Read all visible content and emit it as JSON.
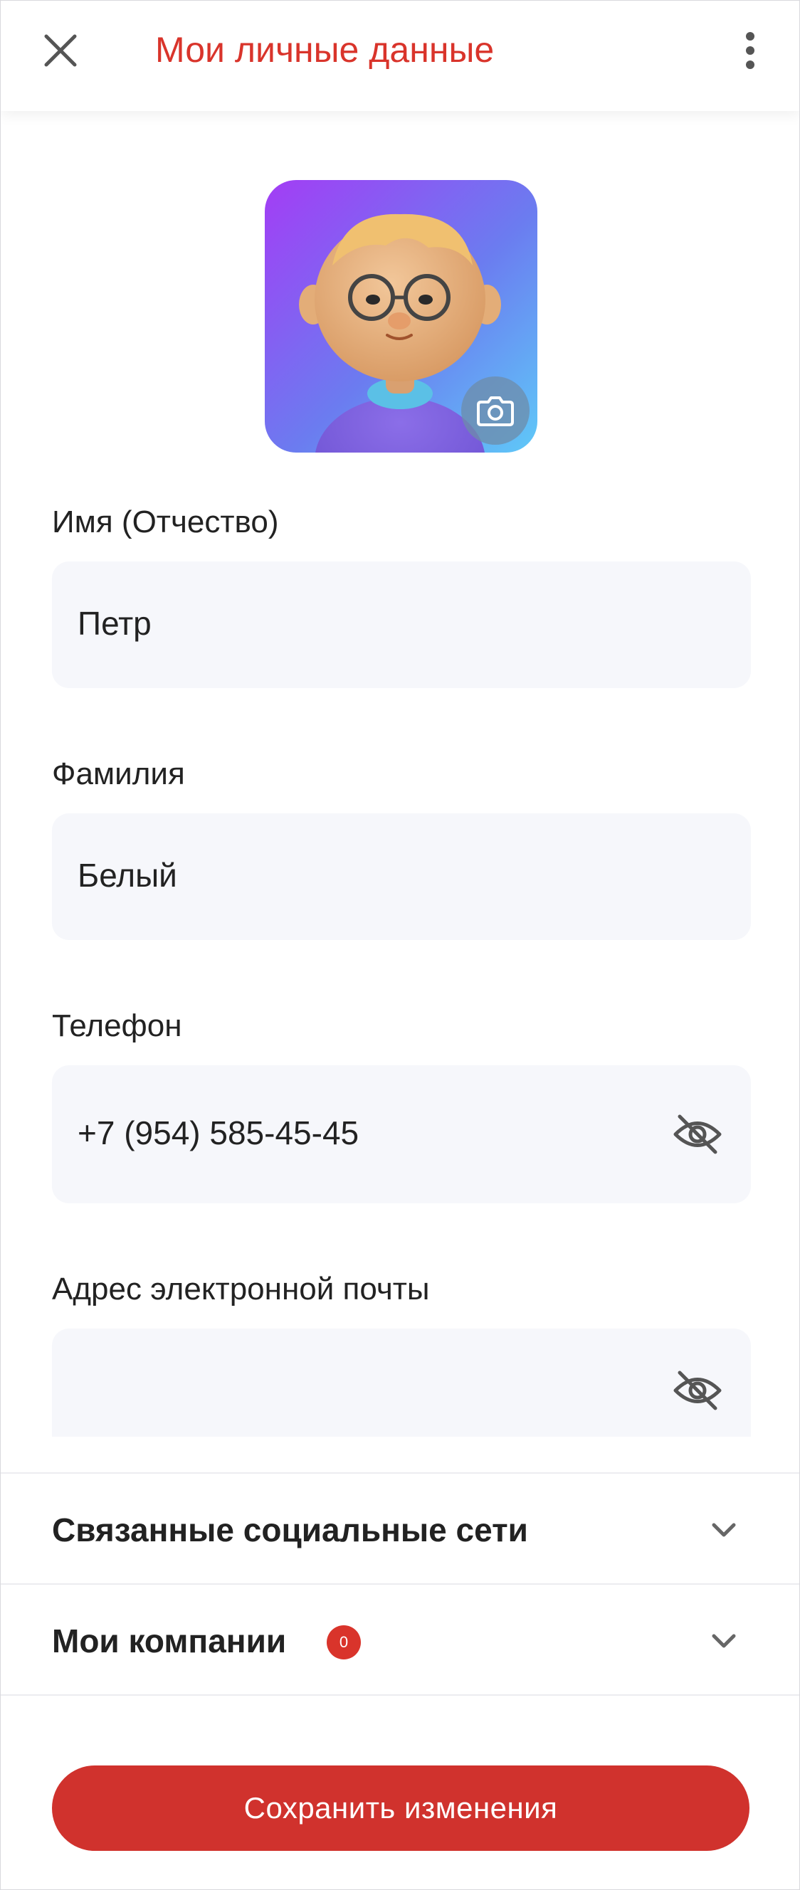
{
  "header": {
    "title": "Мои личные данные",
    "close_icon": "close-icon",
    "menu_icon": "more-vertical-icon",
    "accent_color": "#d9342b"
  },
  "avatar": {
    "description_icon": "avatar-image",
    "camera_icon": "camera-icon"
  },
  "form": {
    "first_name": {
      "label": "Имя (Отчество)",
      "value": "Петр"
    },
    "last_name": {
      "label": "Фамилия",
      "value": "Белый"
    },
    "phone": {
      "label": "Телефон",
      "value": "+7 (954) 585-45-45",
      "visibility_icon": "eye-off-icon"
    },
    "email": {
      "label": "Адрес электронной почты",
      "value": "",
      "visibility_icon": "eye-off-icon"
    }
  },
  "sections": {
    "social": {
      "title": "Связанные социальные сети",
      "icon": "chevron-down-icon"
    },
    "companies": {
      "title": "Мои компании",
      "badge": "0",
      "icon": "chevron-down-icon"
    }
  },
  "actions": {
    "save_label": "Сохранить изменения",
    "save_color": "#d0322d"
  }
}
